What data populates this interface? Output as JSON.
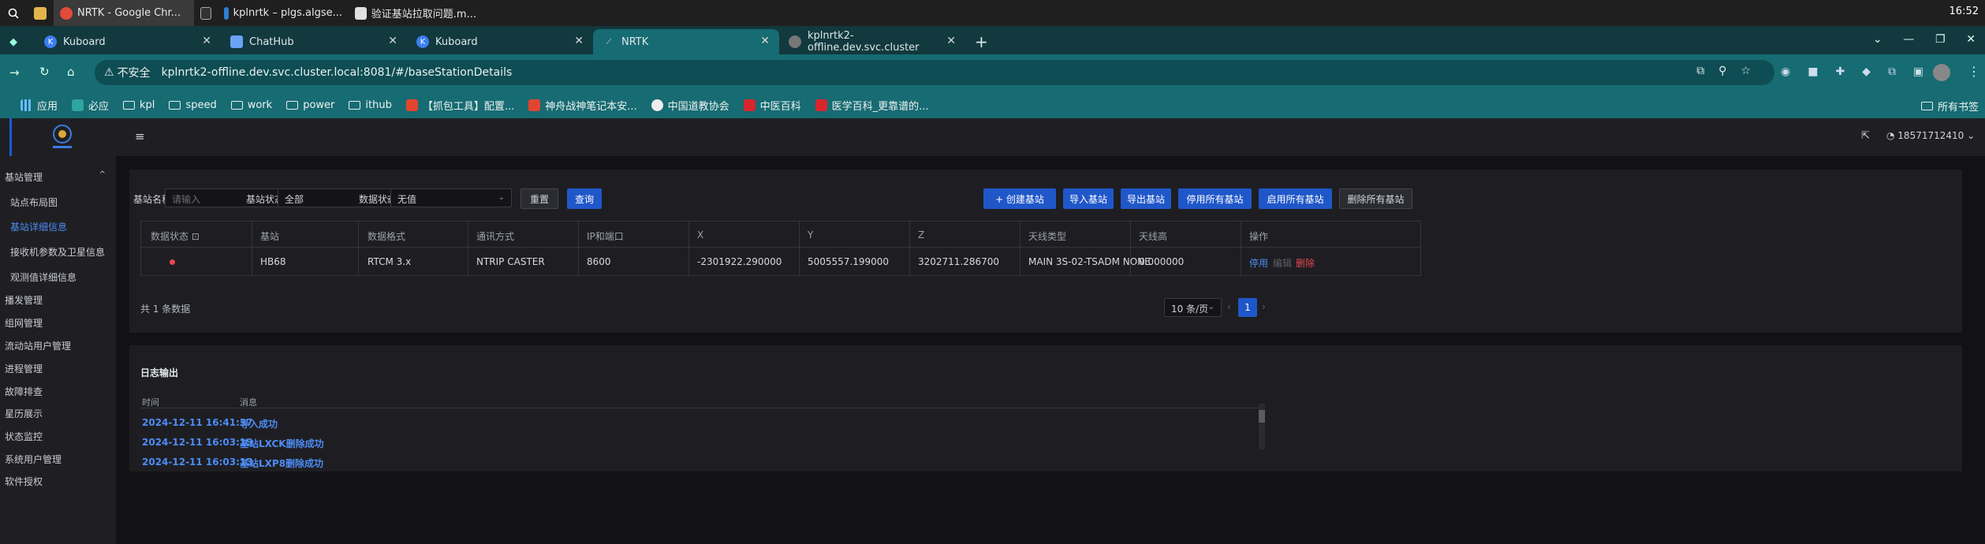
{
  "taskbar": {
    "items": [
      "NRTK - Google Chr...",
      "kplnrtk – plgs.algse...",
      "验证基站拉取问题.m..."
    ],
    "clock": "16:52"
  },
  "browser": {
    "tabs": [
      "Kuboard",
      "ChatHub",
      "Kuboard",
      "NRTK",
      "kplnrtk2-offline.dev.svc.cluster"
    ],
    "security": "不安全",
    "url": "kplnrtk2-offline.dev.svc.cluster.local:8081/#/baseStationDetails",
    "bookmarks": [
      "应用",
      "必应",
      "kpl",
      "speed",
      "work",
      "power",
      "ithub",
      "【抓包工具】配置...",
      "神舟战神笔记本安...",
      "中国道教协会",
      "中医百科",
      "医学百科_更靠谱的..."
    ],
    "all_bookmarks": "所有书签"
  },
  "app": {
    "user": "18571712410",
    "menu": {
      "base_mgmt": "基站管理",
      "subitems": [
        "站点布局图",
        "基站详细信息",
        "接收机参数及卫星信息",
        "观测值详细信息"
      ],
      "others": [
        "播发管理",
        "组网管理",
        "流动站用户管理",
        "进程管理",
        "故障排查",
        "星历展示",
        "状态监控",
        "系统用户管理",
        "软件授权"
      ]
    },
    "filters": {
      "name_label": "基站名称",
      "name_placeholder": "请输入",
      "status_label": "基站状态",
      "status_value": "全部",
      "data_status_label": "数据状态",
      "data_status_value": "无值",
      "reset": "重置",
      "query": "查询"
    },
    "actions": [
      "+ 创建基站",
      "导入基站",
      "导出基站",
      "停用所有基站",
      "启用所有基站",
      "删除所有基站"
    ],
    "table": {
      "headers": [
        "数据状态",
        "基站",
        "数据格式",
        "通讯方式",
        "IP和端口",
        "X",
        "Y",
        "Z",
        "天线类型",
        "天线高",
        "操作"
      ],
      "row": [
        "HB68",
        "RTCM 3.x",
        "NTRIP CASTER",
        "8600",
        "-2301922.290000",
        "5005557.199000",
        "3202711.286700",
        "MAIN 3S-02-TSADM NONE",
        "0.000000"
      ],
      "ops": [
        "停用",
        "编辑",
        "删除"
      ],
      "total": "共 1 条数据",
      "page_size": "10 条/页",
      "page": "1"
    },
    "log": {
      "title": "日志输出",
      "headers": [
        "时间",
        "消息"
      ],
      "rows": [
        {
          "time": "2024-12-11 16:41:37",
          "msg": "导入成功"
        },
        {
          "time": "2024-12-11 16:03:19",
          "msg": "基站LXCK删除成功"
        },
        {
          "time": "2024-12-11 16:03:13",
          "msg": "基站LXP8删除成功"
        }
      ]
    }
  },
  "colors": {
    "accent": "#1f57c9",
    "link": "#4d8cf5",
    "danger": "#e5484d",
    "chrome": "#176b72"
  }
}
